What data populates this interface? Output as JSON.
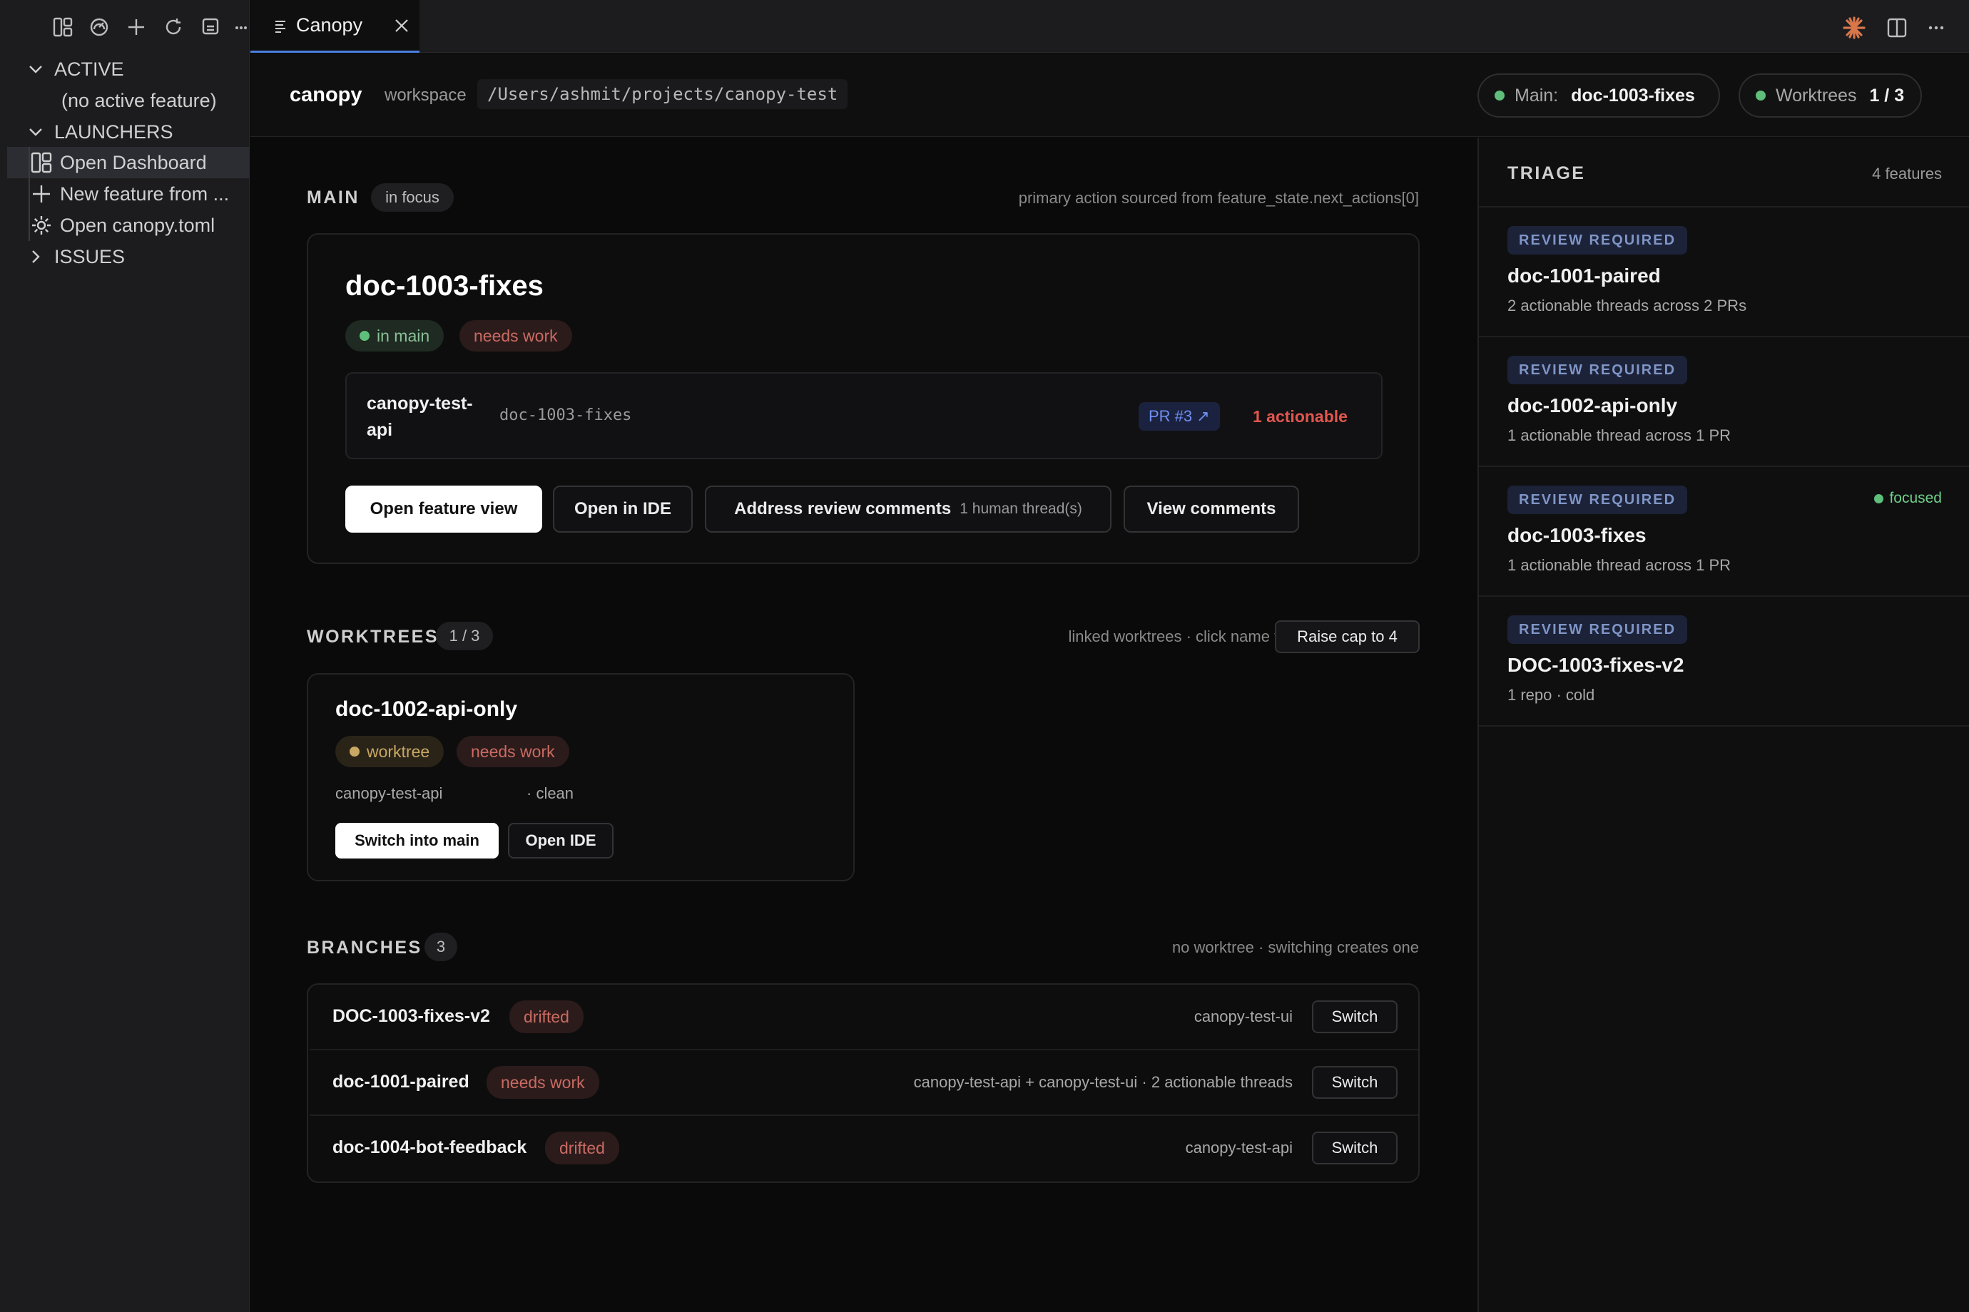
{
  "sidebar": {
    "sections": {
      "active": "ACTIVE",
      "no_active": "(no active feature)",
      "launchers": "LAUNCHERS",
      "issues": "ISSUES"
    },
    "launchers": [
      {
        "label": "Open Dashboard",
        "icon": "dashboard-icon"
      },
      {
        "label": "New feature from ...",
        "icon": "plus-icon"
      },
      {
        "label": "Open canopy.toml",
        "icon": "gear-icon"
      }
    ]
  },
  "tab": {
    "title": "Canopy"
  },
  "header": {
    "brand": "canopy",
    "workspace_label": "workspace",
    "workspace_path": "/Users/ashmit/projects/canopy-test",
    "main_label": "Main:",
    "main_value": "doc-1003-fixes",
    "worktrees_label": "Worktrees",
    "worktrees_value": "1 / 3"
  },
  "main_section": {
    "title": "MAIN",
    "chip": "in focus",
    "hint": "primary action sourced from feature_state.next_actions[0]",
    "feature": "doc-1003-fixes",
    "badges": [
      "in main",
      "needs work"
    ],
    "repo_line1": "canopy-test-",
    "repo_line2": "api",
    "branch": "doc-1003-fixes",
    "pr": "PR #3 ↗",
    "actionable": "1 actionable",
    "buttons": {
      "open_feature": "Open feature view",
      "open_ide": "Open in IDE",
      "address": "Address review comments",
      "address_sub": "1 human thread(s)",
      "view_comments": "View comments"
    }
  },
  "worktrees": {
    "title": "WORKTREES",
    "count": "1 / 3",
    "hint": "linked worktrees · click name to drill in",
    "raise_cap": "Raise cap to 4",
    "card": {
      "name": "doc-1002-api-only",
      "badges": [
        "worktree",
        "needs work"
      ],
      "repo": "canopy-test-api",
      "state": "· clean",
      "switch": "Switch into main",
      "open_ide": "Open IDE"
    }
  },
  "branches": {
    "title": "BRANCHES",
    "count": "3",
    "hint": "no worktree · switching creates one",
    "switch_label": "Switch",
    "rows": [
      {
        "name": "DOC-1003-fixes-v2",
        "badge": "drifted",
        "meta": "canopy-test-ui"
      },
      {
        "name": "doc-1001-paired",
        "badge": "needs work",
        "meta": "canopy-test-api + canopy-test-ui · 2 actionable threads"
      },
      {
        "name": "doc-1004-bot-feedback",
        "badge": "drifted",
        "meta": "canopy-test-api"
      }
    ]
  },
  "triage": {
    "title": "TRIAGE",
    "count": "4 features",
    "focused": "focused",
    "items": [
      {
        "badge": "REVIEW REQUIRED",
        "name": "doc-1001-paired",
        "sub": "2 actionable threads across 2 PRs"
      },
      {
        "badge": "REVIEW REQUIRED",
        "name": "doc-1002-api-only",
        "sub": "1 actionable thread across 1 PR"
      },
      {
        "badge": "REVIEW REQUIRED",
        "name": "doc-1003-fixes",
        "sub": "1 actionable thread across 1 PR"
      },
      {
        "badge": "REVIEW REQUIRED",
        "name": "DOC-1003-fixes-v2",
        "sub": "1 repo · cold"
      }
    ]
  },
  "colors": {
    "accent": "#4a7fe0",
    "danger": "#e0574f",
    "success": "#5fbf7a",
    "claude": "#d9774b"
  }
}
